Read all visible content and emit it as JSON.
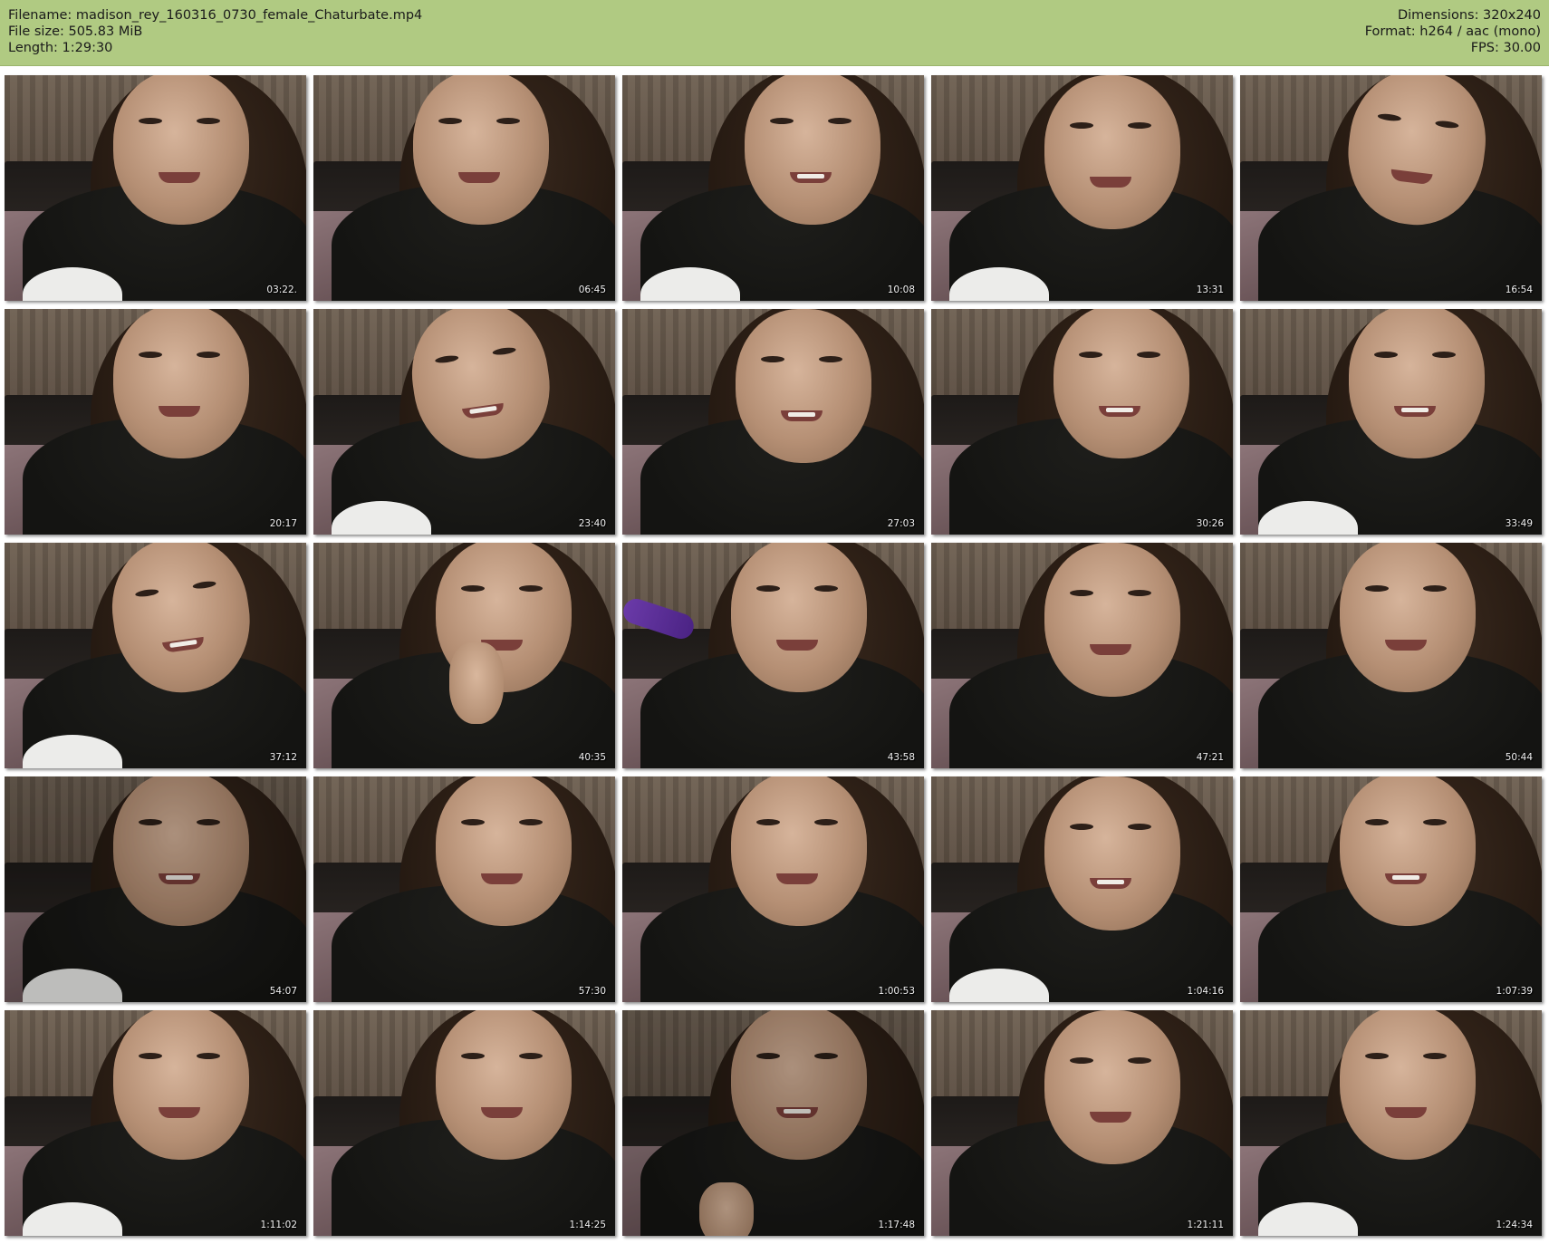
{
  "header": {
    "filename_line": "Filename: madison_rey_160316_0730_female_Chaturbate.mp4",
    "filesize_line": "File size: 505.83 MiB",
    "length_line": "Length: 1:29:30",
    "dimensions_line": "Dimensions: 320x240",
    "format_line": "Format: h264 / aac (mono)",
    "fps_line": "FPS: 30.00"
  },
  "colors": {
    "header_background": "#b0ca82",
    "page_background": "#ffffff",
    "timestamp_text": "#f2f2f2"
  },
  "thumbnails": [
    {
      "timestamp": "03:22."
    },
    {
      "timestamp": "06:45"
    },
    {
      "timestamp": "10:08"
    },
    {
      "timestamp": "13:31"
    },
    {
      "timestamp": "16:54"
    },
    {
      "timestamp": "20:17"
    },
    {
      "timestamp": "23:40"
    },
    {
      "timestamp": "27:03"
    },
    {
      "timestamp": "30:26"
    },
    {
      "timestamp": "33:49"
    },
    {
      "timestamp": "37:12"
    },
    {
      "timestamp": "40:35"
    },
    {
      "timestamp": "43:58"
    },
    {
      "timestamp": "47:21"
    },
    {
      "timestamp": "50:44"
    },
    {
      "timestamp": "54:07"
    },
    {
      "timestamp": "57:30"
    },
    {
      "timestamp": "1:00:53"
    },
    {
      "timestamp": "1:04:16"
    },
    {
      "timestamp": "1:07:39"
    },
    {
      "timestamp": "1:11:02"
    },
    {
      "timestamp": "1:14:25"
    },
    {
      "timestamp": "1:17:48"
    },
    {
      "timestamp": "1:21:11"
    },
    {
      "timestamp": "1:24:34"
    }
  ]
}
